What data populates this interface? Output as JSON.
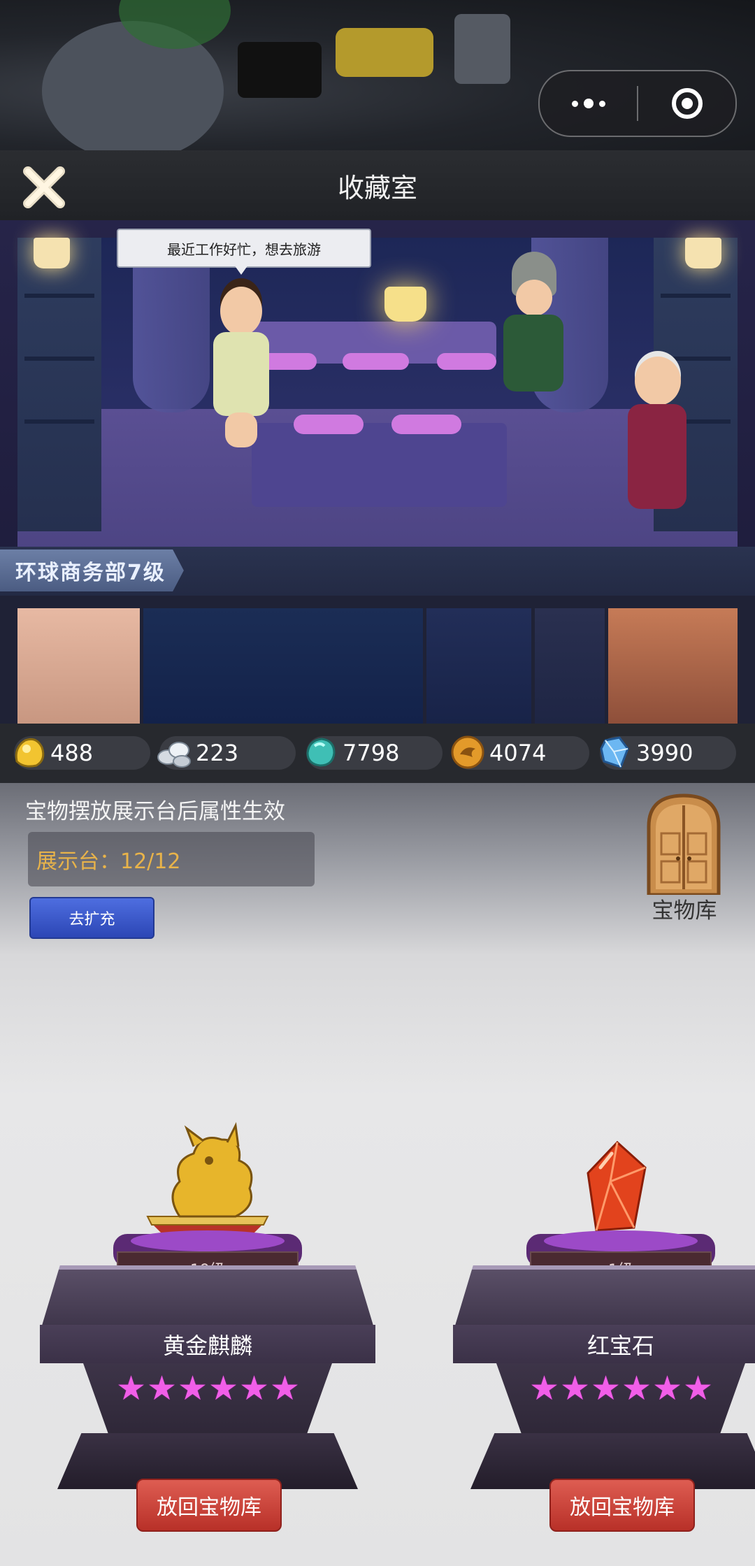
{
  "window": {
    "title": "收藏室"
  },
  "room": {
    "speech": "最近工作好忙，想去旅游",
    "level_tag": "环球商务部7级"
  },
  "resources": [
    {
      "icon": "gold-nugget-icon",
      "value": "488"
    },
    {
      "icon": "silver-ore-icon",
      "value": "223"
    },
    {
      "icon": "jade-gem-icon",
      "value": "7798"
    },
    {
      "icon": "bronze-coin-icon",
      "value": "4074"
    },
    {
      "icon": "blue-crystal-icon",
      "value": "3990"
    }
  ],
  "panel": {
    "hint": "宝物摆放展示台后属性生效",
    "slots": "展示台：12/12",
    "expand_label": "去扩充",
    "vault_label": "宝物库"
  },
  "treasures": [
    {
      "name": "黄金麒麟",
      "level": "19级",
      "stars": 6,
      "return_label": "放回宝物库",
      "icon": "golden-qilin-icon"
    },
    {
      "name": "红宝石",
      "level": "1级",
      "stars": 6,
      "return_label": "放回宝物库",
      "icon": "ruby-icon"
    }
  ],
  "colors": {
    "star": "#f15ee8",
    "return_button": "#c8392f",
    "expand_button": "#3a56c8",
    "slot_text": "#e8b34a"
  }
}
